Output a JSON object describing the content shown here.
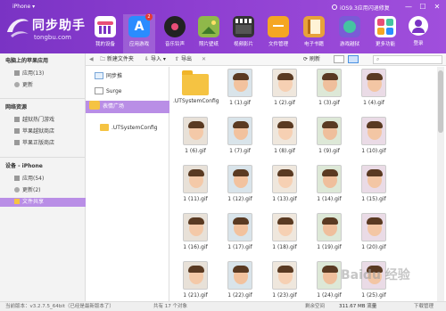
{
  "window": {
    "title": "iPhone ▾",
    "min": "—",
    "max": "☐",
    "close": "✕"
  },
  "notice": "iOS9.3应用闪退修复",
  "brand": {
    "name": "同步助手",
    "url": "tongbu.com"
  },
  "nav": [
    {
      "label": "我的设备",
      "icon": "device-icon",
      "color": "#ffffff"
    },
    {
      "label": "应用游戏",
      "icon": "app-store-icon",
      "color": "#2a8cff",
      "badge": "2",
      "active": true
    },
    {
      "label": "音乐铃声",
      "icon": "music-icon",
      "color": "#222222"
    },
    {
      "label": "照片壁纸",
      "icon": "photo-icon",
      "color": "#8fb84a"
    },
    {
      "label": "视频影片",
      "icon": "video-icon",
      "color": "#333333"
    },
    {
      "label": "文件管理",
      "icon": "folder-icon",
      "color": "#f5a623"
    },
    {
      "label": "电子书籍",
      "icon": "book-icon",
      "color": "#e8a23a"
    },
    {
      "label": "游戏越狱",
      "icon": "jailbreak-icon",
      "color": "#7a5bd6"
    },
    {
      "label": "更多功能",
      "icon": "more-icon",
      "color": "#e94e77"
    }
  ],
  "login": "登录",
  "sidebar": {
    "computer": {
      "title": "电脑上的苹果应用",
      "items": [
        "应用(13)",
        "更新"
      ]
    },
    "resources": {
      "title": "网络资源",
      "items": [
        "越狱热门游戏",
        "苹果越狱商店",
        "苹果正版商店"
      ]
    },
    "device": {
      "title": "设备 - iPhone",
      "items": [
        "应用(54)",
        "更新(2)",
        "文件共享"
      ]
    }
  },
  "toolbar": {
    "new_folder": "新建文件夹",
    "import": "导入",
    "export": "导出",
    "refresh": "刷新",
    "search_placeholder": ""
  },
  "tree": [
    "同步推",
    "Surge",
    "表情广场",
    ".UTSystemConfig"
  ],
  "files": [
    ".UTSystemConfig",
    "1 (1).gif",
    "1 (2).gif",
    "1 (3).gif",
    "1 (4).gif",
    "1 (6).gif",
    "1 (7).gif",
    "1 (8).gif",
    "1 (9).gif",
    "1 (10).gif",
    "1 (11).gif",
    "1 (12).gif",
    "1 (13).gif",
    "1 (14).gif",
    "1 (15).gif",
    "1 (16).gif",
    "1 (17).gif",
    "1 (18).gif",
    "1 (19).gif",
    "1 (20).gif",
    "1 (21).gif",
    "1 (22).gif",
    "1 (23).gif",
    "1 (24).gif",
    "1 (25).gif"
  ],
  "status": {
    "version": "当前版本：v3.2.7.5_64bit（已经是最新版本了）",
    "count": "共有 17 个对象",
    "storage": "剩余空间",
    "size": "311.67 MB 流量",
    "downloads": "下载管理"
  },
  "watermark": "Baidu 经验",
  "colors": {
    "header": "#8e3fd1",
    "selection": "#b98ee6"
  }
}
